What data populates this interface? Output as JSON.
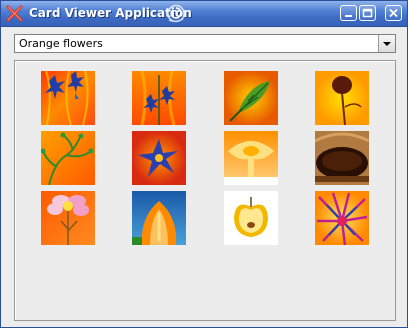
{
  "window": {
    "title": "Card Viewer Application",
    "title_color": "#3d6bc4"
  },
  "controls": {
    "minimize_icon": "minimize-icon",
    "maximize_icon": "maximize-icon",
    "close_icon": "close-icon"
  },
  "category_select": {
    "selected": "Orange flowers",
    "arrow_icon": "chevron-down-icon"
  },
  "cards": [
    {
      "subject": "blue-flowers-on-orange",
      "colors": [
        "#ff5a00",
        "#1d3fa8"
      ]
    },
    {
      "subject": "blue-flower-stems-on-orange",
      "colors": [
        "#ff6a00",
        "#1f3c9e"
      ]
    },
    {
      "subject": "green-leaf-on-orange",
      "colors": [
        "#f08a00",
        "#3a9a2a"
      ]
    },
    {
      "subject": "dark-seed-head-on-yellow",
      "colors": [
        "#ffc400",
        "#5a1a0a"
      ]
    },
    {
      "subject": "green-branches-on-orange",
      "colors": [
        "#ff7a00",
        "#2f8a2a"
      ]
    },
    {
      "subject": "blue-star-flower-on-red",
      "colors": [
        "#e23010",
        "#2a3fb0"
      ]
    },
    {
      "subject": "yellow-trumpet-flower",
      "colors": [
        "#ffa000",
        "#ffe080"
      ]
    },
    {
      "subject": "brown-bowl-closeup",
      "colors": [
        "#8a4a18",
        "#2a1004"
      ]
    },
    {
      "subject": "pink-blossom-on-orange",
      "colors": [
        "#ff6a00",
        "#f2a0c8"
      ]
    },
    {
      "subject": "orange-calla-lily-on-blue",
      "colors": [
        "#ff8a00",
        "#2a70b8"
      ]
    },
    {
      "subject": "yellow-apple-slice-on-white",
      "colors": [
        "#ffffff",
        "#f2b800"
      ]
    },
    {
      "subject": "magenta-flower-burst",
      "colors": [
        "#ffb000",
        "#c02090"
      ]
    }
  ]
}
